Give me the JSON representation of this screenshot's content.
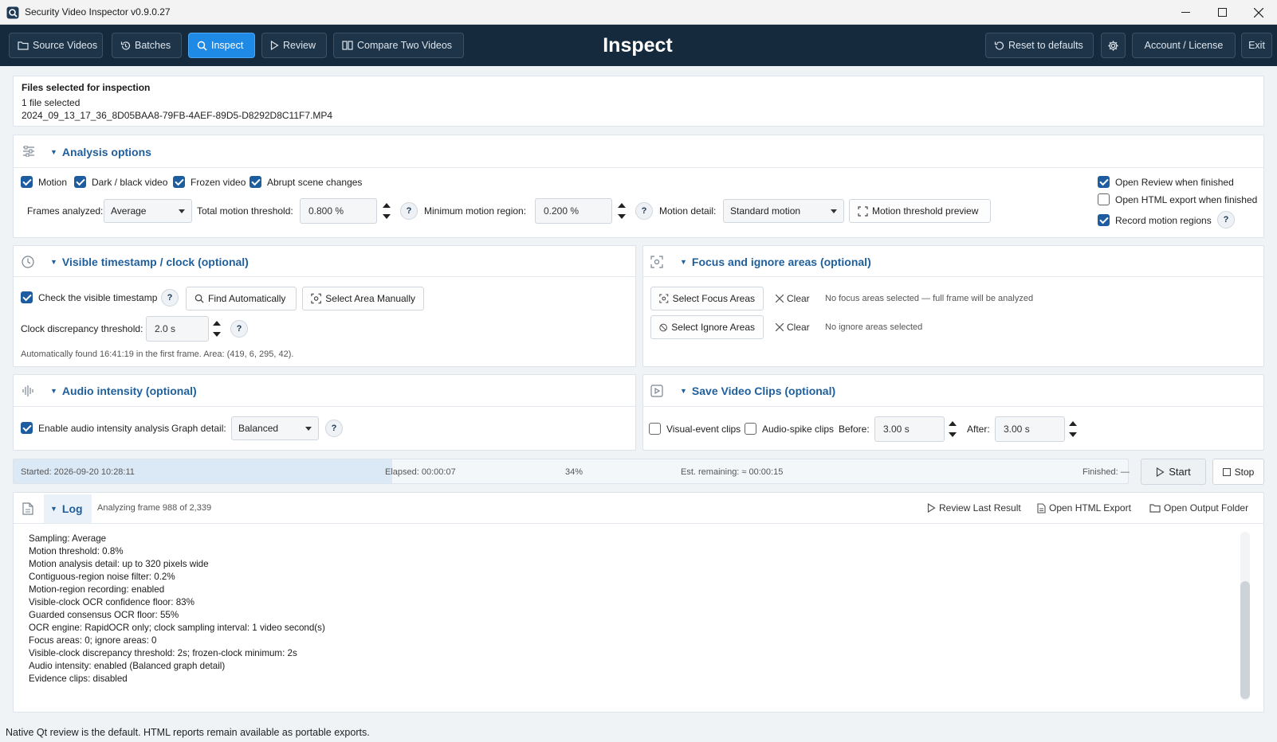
{
  "window": {
    "title": "Security Video Inspector v0.9.0.27"
  },
  "toolbar": {
    "buttons": [
      "Source Videos",
      "Batches",
      "Inspect",
      "Review",
      "Compare Two Videos"
    ],
    "heading": "Inspect",
    "right_buttons": [
      "Reset to defaults",
      "Account / License",
      "Exit"
    ]
  },
  "files": {
    "title": "Files selected for inspection",
    "count": "1 file selected",
    "filename": "2024_09_13_17_36_8D05BAA8-79FB-4AEF-89D5-D8292D8C11F7.MP4"
  },
  "analysis": {
    "title": "Analysis options",
    "checks": [
      {
        "label": "Motion",
        "checked": true
      },
      {
        "label": "Dark / black video",
        "checked": true
      },
      {
        "label": "Frozen video",
        "checked": true
      },
      {
        "label": "Abrupt scene changes",
        "checked": true
      }
    ],
    "frames_label": "Frames analyzed:",
    "frames_value": "Average",
    "total_label": "Total motion threshold:",
    "total_value": "0.800 %",
    "min_label": "Minimum motion region:",
    "min_value": "0.200 %",
    "detail_label": "Motion detail:",
    "detail_value": "Standard motion",
    "preview_btn": "Motion threshold preview",
    "right_checks": [
      {
        "label": "Open Review when finished",
        "checked": true
      },
      {
        "label": "Open HTML export when finished",
        "checked": false
      },
      {
        "label": "Record motion regions",
        "checked": true
      }
    ],
    "help": "?"
  },
  "timestamp": {
    "title": "Visible timestamp / clock (optional)",
    "check_label": "Check the visible timestamp",
    "find_btn": "Find Automatically",
    "select_btn": "Select Area Manually",
    "threshold_label": "Clock discrepancy threshold:",
    "threshold_value": "2.0 s",
    "note": "Automatically found 16:41:19 in the first frame. Area: (419, 6, 295, 42)."
  },
  "focus": {
    "title": "Focus and ignore areas (optional)",
    "focus_btn": "Select Focus Areas",
    "ignore_btn": "Select Ignore Areas",
    "clear": "Clear",
    "focus_note": "No focus areas selected — full frame will be analyzed",
    "ignore_note": "No ignore areas selected"
  },
  "audio": {
    "title": "Audio intensity (optional)",
    "check_label": "Enable audio intensity analysis",
    "graph_label": "Graph detail:",
    "graph_value": "Balanced"
  },
  "clips": {
    "title": "Save Video Clips (optional)",
    "visual_label": "Visual-event clips",
    "audio_label": "Audio-spike clips",
    "before_label": "Before:",
    "before_value": "3.00 s",
    "after_label": "After:",
    "after_value": "3.00 s"
  },
  "progress": {
    "started": "Started: 2026-09-20 10:28:11",
    "elapsed": "Elapsed: 00:00:07",
    "percent": "34%",
    "fraction": 0.34,
    "remaining": "Est. remaining: ≈ 00:00:15",
    "finished": "Finished: —",
    "start_btn": "Start",
    "stop_btn": "Stop"
  },
  "log": {
    "title": "Log",
    "status": "Analyzing frame 988 of 2,339",
    "actions": [
      "Review Last Result",
      "Open HTML Export",
      "Open Output Folder"
    ],
    "lines": [
      "Sampling: Average",
      "Motion threshold: 0.8%",
      "Motion analysis detail: up to 320 pixels wide",
      "Contiguous-region noise filter: 0.2%",
      "Motion-region recording: enabled",
      "Visible-clock OCR confidence floor: 83%",
      "Guarded consensus OCR floor: 55%",
      "OCR engine: RapidOCR only; clock sampling interval: 1 video second(s)",
      "Focus areas: 0; ignore areas: 0",
      "Visible-clock discrepancy threshold: 2s; frozen-clock minimum: 2s",
      "Audio intensity: enabled (Balanced graph detail)",
      "Evidence clips: disabled"
    ]
  },
  "statusbar": {
    "text": "Native Qt review is the default. HTML reports remain available as portable exports."
  },
  "colors": {
    "toolbar_bg": "#162a3d",
    "accent": "#1f8ae6",
    "section_title": "#1f5f9c",
    "checkbox": "#1d5c9e"
  }
}
